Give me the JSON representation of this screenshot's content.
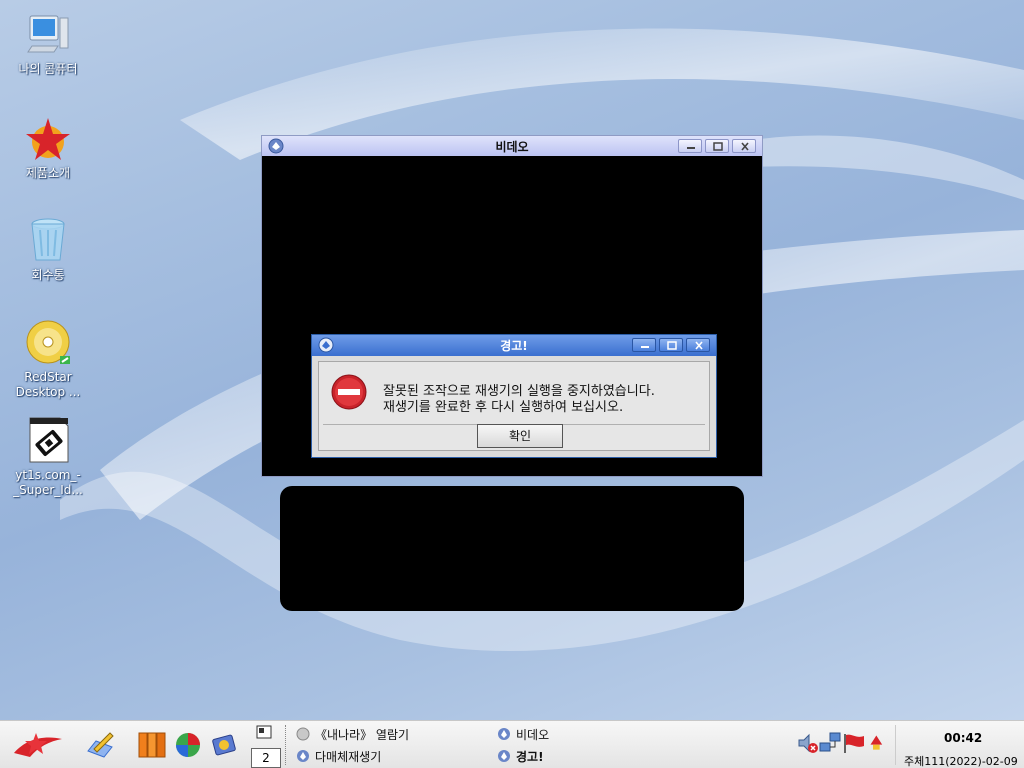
{
  "desktop": {
    "icons": [
      {
        "label": "나의 콤퓨터"
      },
      {
        "label": "제품소개"
      },
      {
        "label": "회수통"
      },
      {
        "label": "RedStar Desktop ..."
      },
      {
        "label": "yt1s.com_-_Super_Id..."
      }
    ]
  },
  "video_window": {
    "title": "비데오"
  },
  "alert_dialog": {
    "title": "경고!",
    "message_line1": "잘못된 조작으로 재생기의 실행을 중지하였습니다.",
    "message_line2": "재생기를 완료한 후 다시 실행하여 보십시오.",
    "ok_label": "확인"
  },
  "taskbar": {
    "workspace_number": "2",
    "tasks": [
      {
        "label": "《내나라》 열람기"
      },
      {
        "label": "비데오"
      },
      {
        "label": "다매체재생기"
      },
      {
        "label": "경고!"
      }
    ],
    "clock": "00:42",
    "date": "주체111(2022)-02-09"
  }
}
